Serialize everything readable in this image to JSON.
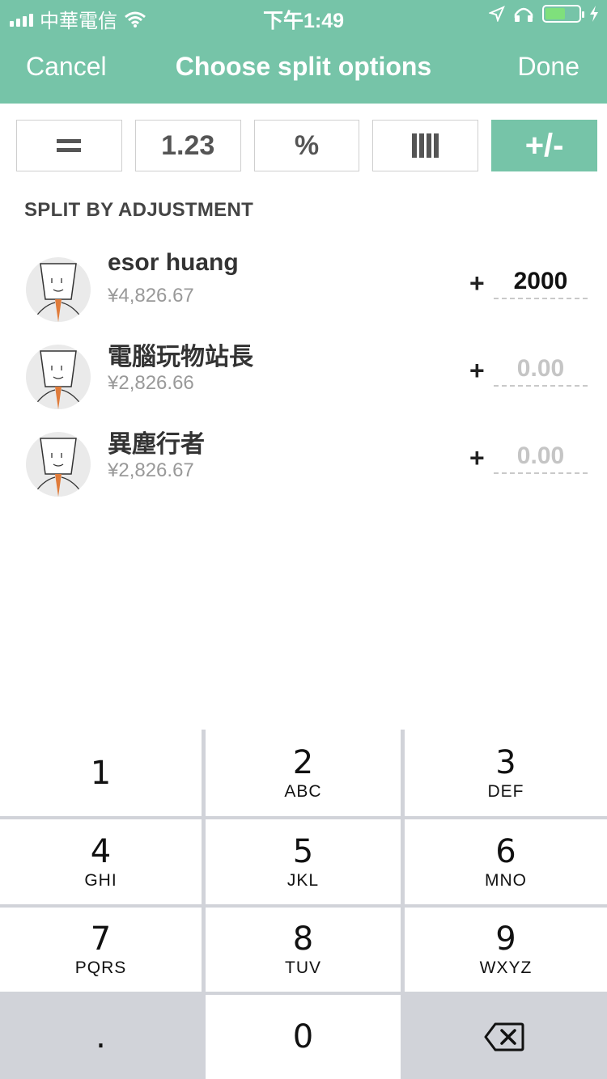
{
  "status_bar": {
    "carrier": "中華電信",
    "time": "下午1:49"
  },
  "nav": {
    "cancel_label": "Cancel",
    "title": "Choose split options",
    "done_label": "Done"
  },
  "split_options": [
    {
      "label": "",
      "icon": "equals-icon"
    },
    {
      "label": "1.23",
      "icon": ""
    },
    {
      "label": "%",
      "icon": ""
    },
    {
      "label": "",
      "icon": "shares-icon"
    },
    {
      "label": "+/-",
      "icon": "",
      "active": true
    }
  ],
  "section_title": "SPLIT BY ADJUSTMENT",
  "people": [
    {
      "name": "esor huang",
      "amount": "¥4,826.67",
      "sign": "+",
      "value": "2000",
      "placeholder": "0.00"
    },
    {
      "name": "電腦玩物站長",
      "amount": "¥2,826.66",
      "sign": "+",
      "value": "",
      "placeholder": "0.00"
    },
    {
      "name": "異塵行者",
      "amount": "¥2,826.67",
      "sign": "+",
      "value": "",
      "placeholder": "0.00"
    }
  ],
  "keypad": {
    "keys": [
      {
        "num": "1",
        "letters": ""
      },
      {
        "num": "2",
        "letters": "ABC"
      },
      {
        "num": "3",
        "letters": "DEF"
      },
      {
        "num": "4",
        "letters": "GHI"
      },
      {
        "num": "5",
        "letters": "JKL"
      },
      {
        "num": "6",
        "letters": "MNO"
      },
      {
        "num": "7",
        "letters": "PQRS"
      },
      {
        "num": "8",
        "letters": "TUV"
      },
      {
        "num": "9",
        "letters": "WXYZ"
      }
    ],
    "decimal": ".",
    "zero": "0"
  },
  "colors": {
    "accent": "#76c4a8",
    "keypad_gray": "#d1d3d9"
  }
}
